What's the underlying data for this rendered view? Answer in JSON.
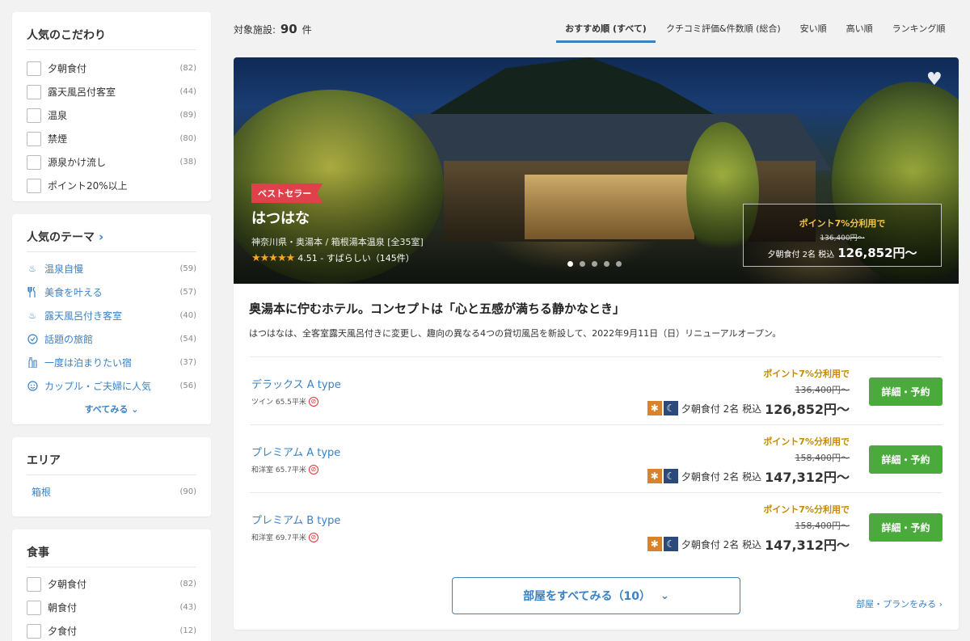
{
  "sidebar": {
    "kodawari": {
      "title": "人気のこだわり",
      "items": [
        {
          "label": "夕朝食付",
          "count": "(82)"
        },
        {
          "label": "露天風呂付客室",
          "count": "(44)"
        },
        {
          "label": "温泉",
          "count": "(89)"
        },
        {
          "label": "禁煙",
          "count": "(80)"
        },
        {
          "label": "源泉かけ流し",
          "count": "(38)"
        },
        {
          "label": "ポイント20%以上",
          "count": ""
        }
      ]
    },
    "theme": {
      "title": "人気のテーマ",
      "chevron": "›",
      "items": [
        {
          "icon": "hot-spring-icon",
          "glyph": "♨",
          "label": "温泉自慢",
          "count": "(59)"
        },
        {
          "icon": "cutlery-icon",
          "glyph": "🍴",
          "label": "美食を叶える",
          "count": "(57)"
        },
        {
          "icon": "outdoor-bath-icon",
          "glyph": "♨",
          "label": "露天風呂付き客室",
          "count": "(40)"
        },
        {
          "icon": "check-badge-icon",
          "glyph": "✓",
          "label": "話題の旅館",
          "count": "(54)"
        },
        {
          "icon": "bottle-icon",
          "glyph": "♦",
          "label": "一度は泊まりたい宿",
          "count": "(37)"
        },
        {
          "icon": "smile-icon",
          "glyph": "☺",
          "label": "カップル・ご夫婦に人気",
          "count": "(56)"
        }
      ],
      "see_all": "すべてみる",
      "see_all_chevron": "⌄"
    },
    "area": {
      "title": "エリア",
      "items": [
        {
          "label": "箱根",
          "count": "(90)"
        }
      ]
    },
    "meal": {
      "title": "食事",
      "items": [
        {
          "label": "夕朝食付",
          "count": "(82)"
        },
        {
          "label": "朝食付",
          "count": "(43)"
        },
        {
          "label": "夕食付",
          "count": "(12)"
        }
      ]
    }
  },
  "top": {
    "count_label": "対象施設:",
    "count_value": "90",
    "count_unit": "件",
    "sorts": [
      "おすすめ順 (すべて)",
      "クチコミ評価&件数順 (総合)",
      "安い順",
      "高い順",
      "ランキング順"
    ],
    "active_sort_index": 0
  },
  "hotel": {
    "badge": "ベストセラー",
    "name": "はつはな",
    "location": "神奈川県・奥湯本 / 箱根湯本温泉 [全35室]",
    "stars": "★★★★★",
    "rating": "4.51 - すばらしい（145件）",
    "slides_total": 5,
    "slide_active": 0,
    "price_box": {
      "point": "ポイント7%分利用で",
      "old": "136,400円〜",
      "meal": "夕朝食付 2名",
      "tax": "税込",
      "price": "126,852円〜"
    },
    "headline": "奥湯本に佇むホテル。コンセプトは「心と五感が満ちる静かなとき」",
    "description": "はつはなは、全客室露天風呂付きに変更し、趣向の異なる4つの貸切風呂を新設して、2022年9月11日（日）リニューアルオープン。",
    "rooms": [
      {
        "name": "デラックス A type",
        "info": "ツイン 65.5平米",
        "point": "ポイント7%分利用で",
        "old": "136,400円〜",
        "meal": "夕朝食付 2名",
        "tax": "税込",
        "price": "126,852円〜",
        "button": "詳細・予約"
      },
      {
        "name": "プレミアム A type",
        "info": "和洋室 65.7平米",
        "point": "ポイント7%分利用で",
        "old": "158,400円〜",
        "meal": "夕朝食付 2名",
        "tax": "税込",
        "price": "147,312円〜",
        "button": "詳細・予約"
      },
      {
        "name": "プレミアム B type",
        "info": "和洋室 69.7平米",
        "point": "ポイント7%分利用で",
        "old": "158,400円〜",
        "meal": "夕朝食付 2名",
        "tax": "税込",
        "price": "147,312円〜",
        "button": "詳細・予約"
      }
    ],
    "all_rooms_button": "部屋をすべてみる（10）",
    "plan_link": "部屋・プランをみる ›"
  },
  "colors": {
    "accent": "#3b82c4",
    "book_button": "#4aab3c",
    "badge": "#e0404a",
    "point_text": "#c58a00"
  }
}
